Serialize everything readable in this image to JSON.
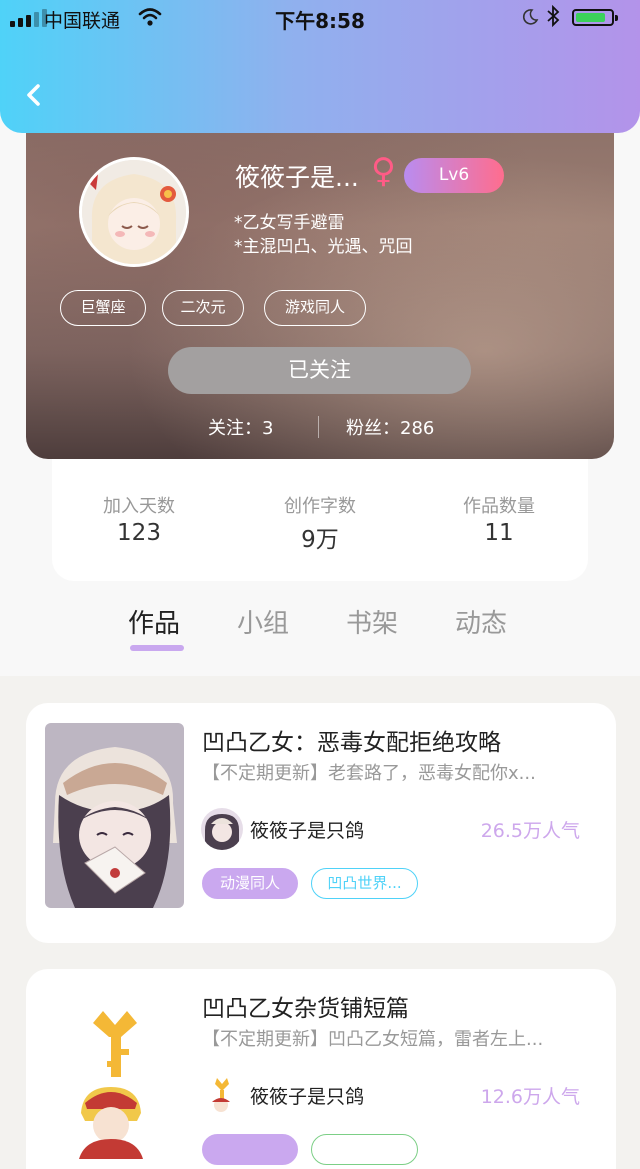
{
  "status_bar": {
    "carrier": "中国联通",
    "time": "下午8:58",
    "battery_level": 0.85
  },
  "colors": {
    "header_gradient": [
      "#4fd2f8",
      "#8fb1ee",
      "#b393ea"
    ],
    "level_gradient": [
      "#b98cf0",
      "#ff6d8e"
    ],
    "tab_underline": "#c9a8ef",
    "popularity_text": "#cda7ec",
    "tag_fill": "#caa8ef",
    "tag_outline": "#4fd2f8",
    "gender_icon": "#ff5b86"
  },
  "icons": {
    "back": "chevron-left-icon",
    "gender": "female-icon",
    "wifi": "wifi-icon",
    "bluetooth": "bluetooth-icon",
    "moon": "moon-icon"
  },
  "profile": {
    "nickname": "筱筱子是...",
    "level": "Lv6",
    "bio_lines": [
      "*乙女写手避雷",
      "*主混凹凸、光遇、咒回"
    ],
    "tags": [
      "巨蟹座",
      "二次元",
      "游戏同人"
    ],
    "follow_button": "已关注",
    "following_label": "关注：3",
    "fans_label": "粉丝：286"
  },
  "stats": [
    {
      "label": "加入天数",
      "value": "123"
    },
    {
      "label": "创作字数",
      "value": "9万"
    },
    {
      "label": "作品数量",
      "value": "11"
    }
  ],
  "tabs": [
    {
      "label": "作品",
      "active": true
    },
    {
      "label": "小组",
      "active": false
    },
    {
      "label": "书架",
      "active": false
    },
    {
      "label": "动态",
      "active": false
    }
  ],
  "works": [
    {
      "title": "凹凸乙女：恶毒女配拒绝攻略",
      "description": "【不定期更新】老套路了，恶毒女配你x...",
      "author": "筱筱子是只鸽",
      "popularity": "26.5万人气",
      "tags": [
        "动漫同人",
        "凹凸世界..."
      ]
    },
    {
      "title": "凹凸乙女杂货铺短篇",
      "description": "【不定期更新】凹凸乙女短篇，雷者左上...",
      "author": "筱筱子是只鸽",
      "popularity": "12.6万人气",
      "tags": [
        "",
        ""
      ]
    }
  ]
}
